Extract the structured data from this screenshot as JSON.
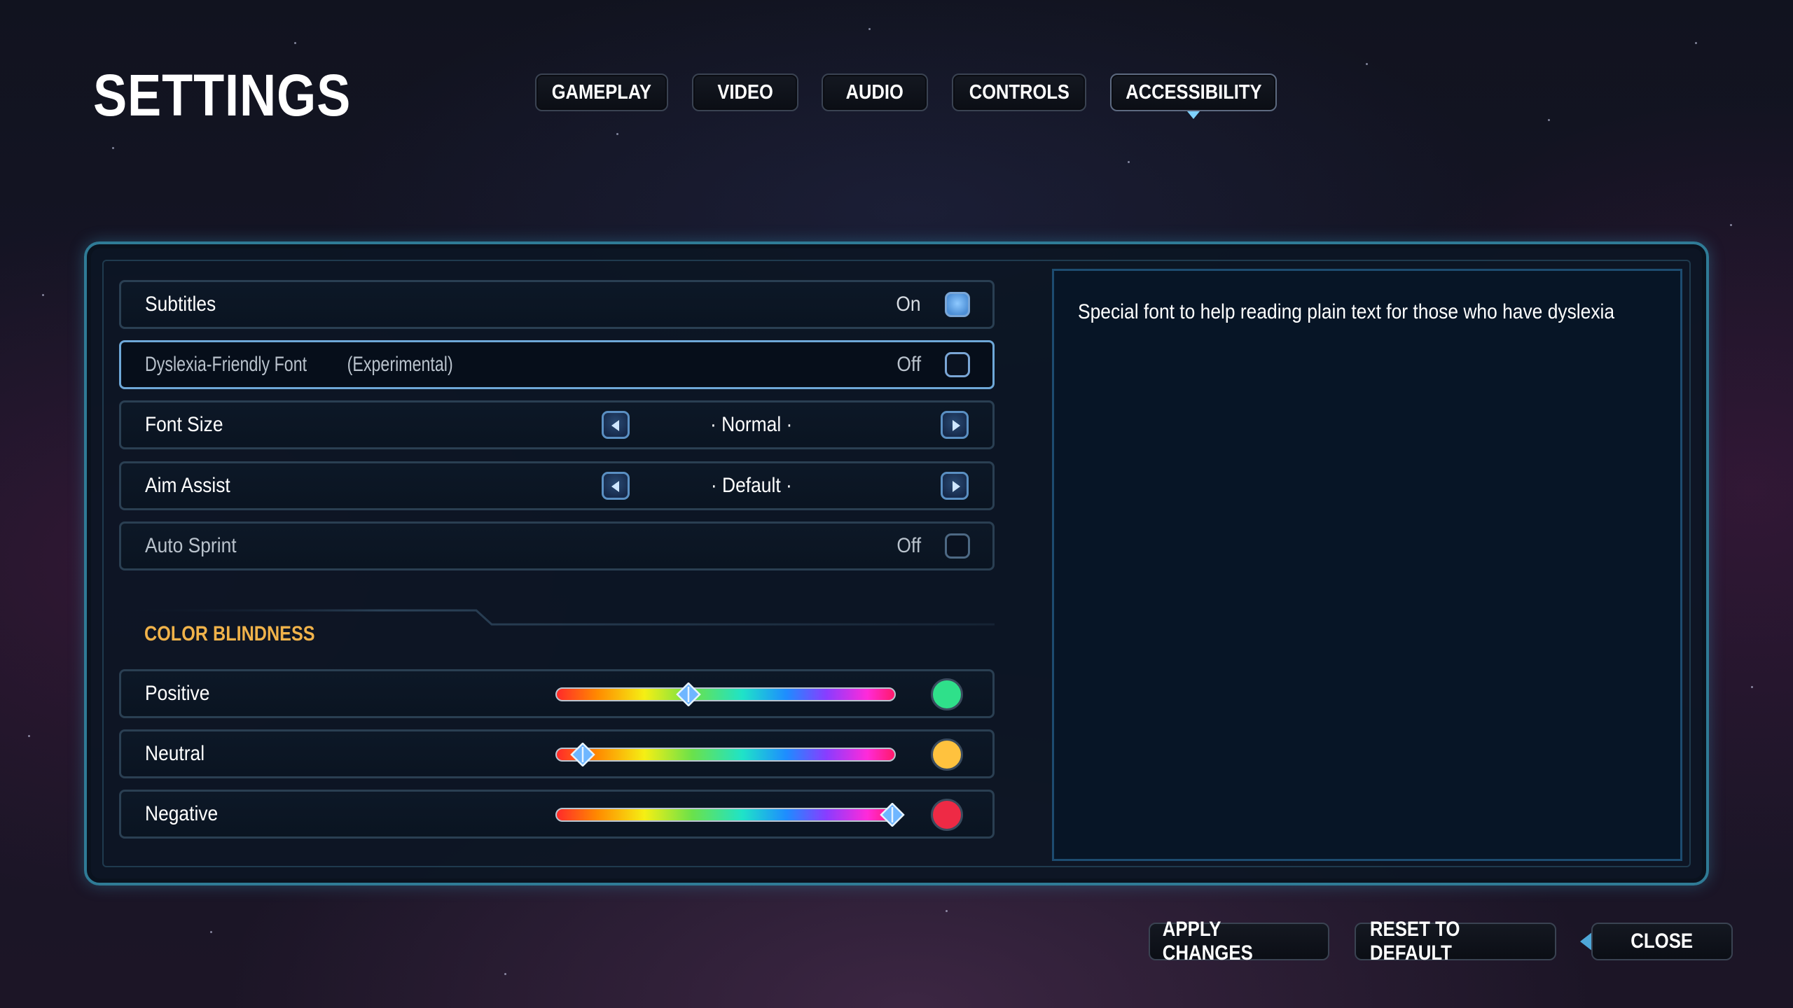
{
  "title": "SETTINGS",
  "tabs": [
    {
      "label": "GAMEPLAY"
    },
    {
      "label": "VIDEO"
    },
    {
      "label": "AUDIO"
    },
    {
      "label": "CONTROLS"
    },
    {
      "label": "ACCESSIBILITY",
      "active": true
    }
  ],
  "settings": {
    "subtitles": {
      "label": "Subtitles",
      "value": "On",
      "checked": true
    },
    "dyslexia_font": {
      "label": "Dyslexia-Friendly Font",
      "tag": "(Experimental)",
      "value": "Off",
      "checked": false
    },
    "font_size": {
      "label": "Font Size",
      "value": "· Normal ·"
    },
    "aim_assist": {
      "label": "Aim Assist",
      "value": "· Default ·"
    },
    "auto_sprint": {
      "label": "Auto Sprint",
      "value": "Off",
      "checked": false
    }
  },
  "color_blindness": {
    "header": "COLOR BLINDNESS",
    "sliders": [
      {
        "label": "Positive",
        "level": 0.39,
        "color": "#2fe08a"
      },
      {
        "label": "Neutral",
        "level": 0.08,
        "color": "#ffc23e"
      },
      {
        "label": "Negative",
        "level": 0.99,
        "color": "#ee2a45"
      }
    ]
  },
  "description": "Special font to help reading plain text for those who have dyslexia",
  "buttons": {
    "apply": "APPLY CHANGES",
    "reset": "RESET TO DEFAULT",
    "close": "CLOSE"
  },
  "colors": {
    "accent": "#2f7b96",
    "section_header": "#f0b24a",
    "toggle_on": "#6fb3f5"
  }
}
